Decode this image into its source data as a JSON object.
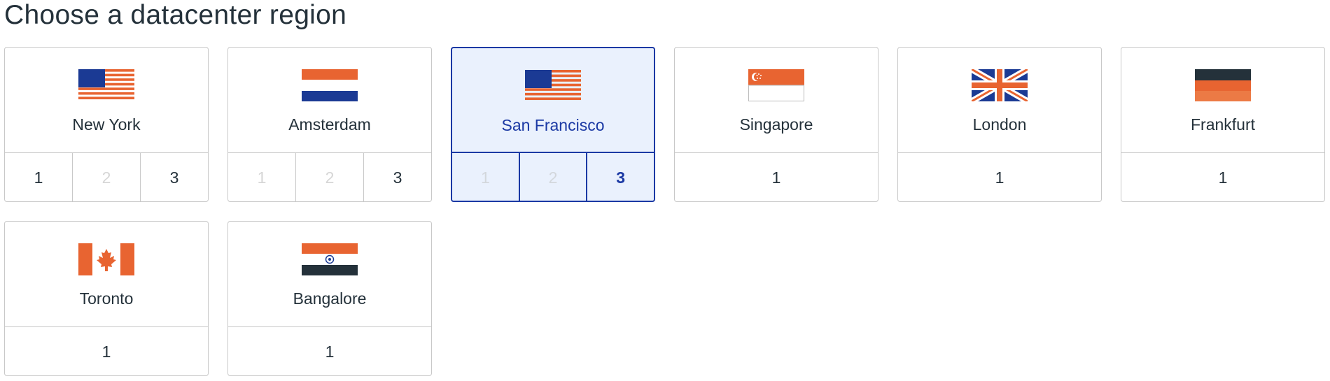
{
  "title": "Choose a datacenter region",
  "colors": {
    "accent": "#1b39a4",
    "selected_bg": "#eaf1fd",
    "flag_orange": "#e86431",
    "flag_blue": "#1b3a94",
    "flag_dark": "#24313a",
    "disabled_text": "#d6d6d6"
  },
  "regions": [
    {
      "name": "New York",
      "flag": "us-flag-icon",
      "selected": false,
      "datacenters": [
        {
          "label": "1",
          "enabled": true
        },
        {
          "label": "2",
          "enabled": false
        },
        {
          "label": "3",
          "enabled": true
        }
      ]
    },
    {
      "name": "Amsterdam",
      "flag": "netherlands-flag-icon",
      "selected": false,
      "datacenters": [
        {
          "label": "1",
          "enabled": false
        },
        {
          "label": "2",
          "enabled": false
        },
        {
          "label": "3",
          "enabled": true
        }
      ]
    },
    {
      "name": "San Francisco",
      "flag": "us-flag-icon",
      "selected": true,
      "datacenters": [
        {
          "label": "1",
          "enabled": false
        },
        {
          "label": "2",
          "enabled": false
        },
        {
          "label": "3",
          "enabled": true,
          "active": true
        }
      ]
    },
    {
      "name": "Singapore",
      "flag": "singapore-flag-icon",
      "selected": false,
      "datacenters": [
        {
          "label": "1",
          "enabled": true
        }
      ]
    },
    {
      "name": "London",
      "flag": "uk-flag-icon",
      "selected": false,
      "datacenters": [
        {
          "label": "1",
          "enabled": true
        }
      ]
    },
    {
      "name": "Frankfurt",
      "flag": "germany-flag-icon",
      "selected": false,
      "datacenters": [
        {
          "label": "1",
          "enabled": true
        }
      ]
    },
    {
      "name": "Toronto",
      "flag": "canada-flag-icon",
      "selected": false,
      "datacenters": [
        {
          "label": "1",
          "enabled": true
        }
      ]
    },
    {
      "name": "Bangalore",
      "flag": "india-flag-icon",
      "selected": false,
      "datacenters": [
        {
          "label": "1",
          "enabled": true
        }
      ]
    }
  ]
}
